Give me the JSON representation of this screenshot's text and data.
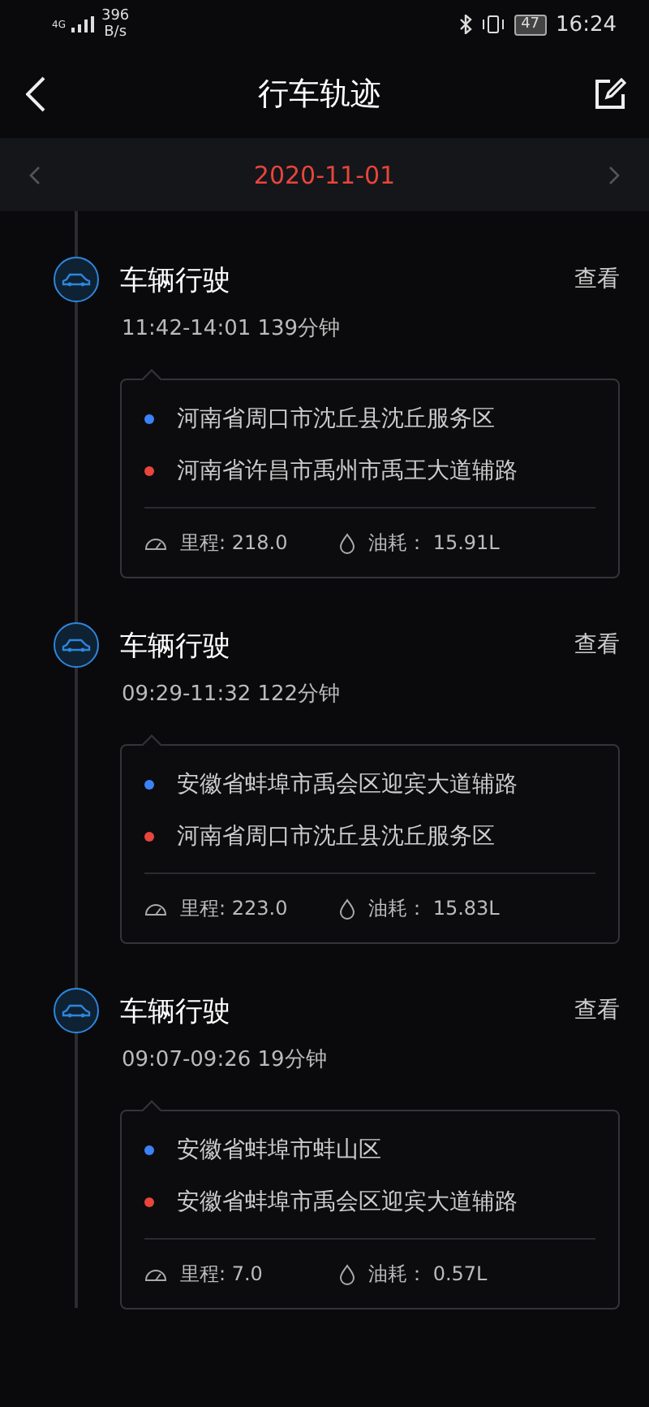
{
  "status_bar": {
    "network": "4G",
    "speed_value": "396",
    "speed_unit": "B/s",
    "battery": "47",
    "time": "16:24"
  },
  "header": {
    "title": "行车轨迹"
  },
  "date_bar": {
    "date": "2020-11-01"
  },
  "trips": [
    {
      "title": "车辆行驶",
      "action": "查看",
      "time": "11:42-14:01 139分钟",
      "start": "河南省周口市沈丘县沈丘服务区",
      "end": "河南省许昌市禹州市禹王大道辅路",
      "mileage": "里程: 218.0",
      "fuel": "油耗：  15.91L"
    },
    {
      "title": "车辆行驶",
      "action": "查看",
      "time": "09:29-11:32 122分钟",
      "start": "安徽省蚌埠市禹会区迎宾大道辅路",
      "end": "河南省周口市沈丘县沈丘服务区",
      "mileage": "里程: 223.0",
      "fuel": "油耗：  15.83L"
    },
    {
      "title": "车辆行驶",
      "action": "查看",
      "time": "09:07-09:26 19分钟",
      "start": "安徽省蚌埠市蚌山区",
      "end": "安徽省蚌埠市禹会区迎宾大道辅路",
      "mileage": "里程: 7.0",
      "fuel": "油耗：  0.57L"
    }
  ]
}
